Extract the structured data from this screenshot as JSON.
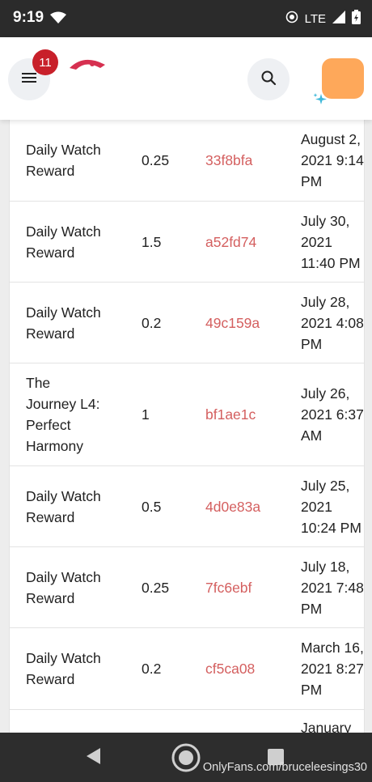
{
  "status_bar": {
    "time": "9:19",
    "network": "LTE"
  },
  "header": {
    "notification_count": "11"
  },
  "rows": [
    {
      "description": [
        "Daily Watch",
        "Reward"
      ],
      "amount": "0.25",
      "tx": "33f8bfa",
      "date": [
        "August 2,",
        "2021 9:14",
        "PM"
      ]
    },
    {
      "description": [
        "Daily Watch",
        "Reward"
      ],
      "amount": "1.5",
      "tx": "a52fd74",
      "date": [
        "July 30,",
        "2021",
        "11:40 PM"
      ]
    },
    {
      "description": [
        "Daily Watch",
        "Reward"
      ],
      "amount": "0.2",
      "tx": "49c159a",
      "date": [
        "July 28,",
        "2021 4:08",
        "PM"
      ]
    },
    {
      "description": [
        "The",
        "Journey L4:",
        "Perfect",
        "Harmony"
      ],
      "amount": "1",
      "tx": "bf1ae1c",
      "date": [
        "July 26,",
        "2021 6:37",
        "AM"
      ]
    },
    {
      "description": [
        "Daily Watch",
        "Reward"
      ],
      "amount": "0.5",
      "tx": "4d0e83a",
      "date": [
        "July 25,",
        "2021",
        "10:24 PM"
      ]
    },
    {
      "description": [
        "Daily Watch",
        "Reward"
      ],
      "amount": "0.25",
      "tx": "7fc6ebf",
      "date": [
        "July 18,",
        "2021 7:48",
        "PM"
      ]
    },
    {
      "description": [
        "Daily Watch",
        "Reward"
      ],
      "amount": "0.2",
      "tx": "cf5ca08",
      "date": [
        "March 16,",
        "2021 8:27",
        "PM"
      ]
    },
    {
      "description": [],
      "amount": "",
      "tx": "",
      "date": [
        "January"
      ]
    }
  ],
  "watermark": "OnlyFans.com/bruceleesings30"
}
